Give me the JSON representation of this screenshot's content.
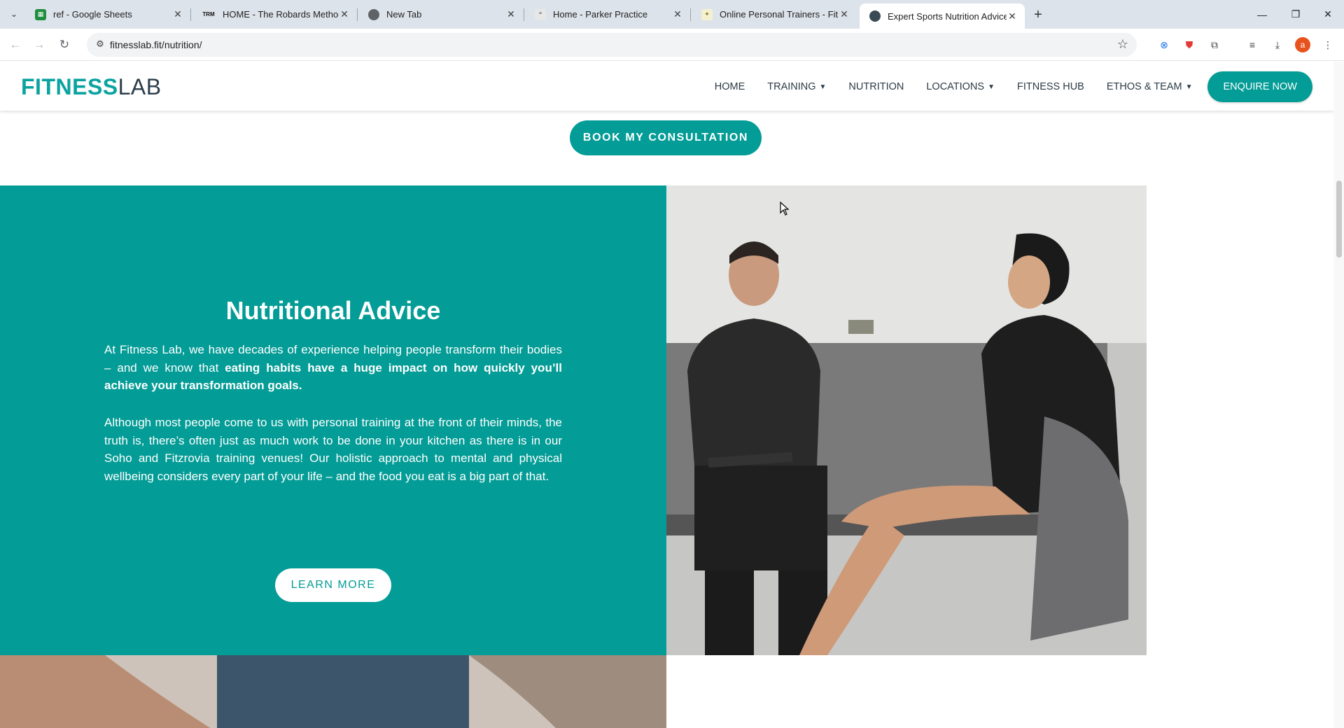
{
  "browser": {
    "tabs": [
      {
        "title": "ref - Google Sheets",
        "favicon": "sheets-icon",
        "active": false
      },
      {
        "title": "HOME - The Robards Method",
        "favicon": "trm-icon",
        "active": false
      },
      {
        "title": "New Tab",
        "favicon": "chrome-icon",
        "active": false
      },
      {
        "title": "Home - Parker Practice",
        "favicon": "pp-icon",
        "active": false
      },
      {
        "title": "Online Personal Trainers - Fitne",
        "favicon": "fitness-icon",
        "active": false
      },
      {
        "title": "Expert Sports Nutrition Advice",
        "favicon": "fitnesslab-icon",
        "active": true
      }
    ],
    "trm_favicon_text": "TRM",
    "url": "fitnesslab.fit/nutrition/",
    "profile_initial": "a"
  },
  "site": {
    "logo_bold": "FITNESS",
    "logo_light": "LAB",
    "nav": [
      {
        "label": "HOME",
        "dropdown": false
      },
      {
        "label": "TRAINING",
        "dropdown": true
      },
      {
        "label": "NUTRITION",
        "dropdown": false
      },
      {
        "label": "LOCATIONS",
        "dropdown": true
      },
      {
        "label": "FITNESS HUB",
        "dropdown": false
      },
      {
        "label": "ETHOS & TEAM",
        "dropdown": true
      }
    ],
    "enquire_label": "ENQUIRE NOW",
    "book_label": "BOOK MY CONSULTATION"
  },
  "section": {
    "heading": "Nutritional Advice",
    "p1_plain": "At Fitness Lab, we have decades of experience helping people transform their bodies – and we know that ",
    "p1_bold": "eating habits have a huge impact on how quickly you’ll achieve your transformation goals.",
    "p2": "Although most people come to us with personal training at the front of their minds, the truth is, there’s often just as much work to be done in your kitchen as there is in our Soho and Fitzrovia training venues! Our holistic approach to mental and physical wellbeing considers every part of your life – and the food you eat is a big part of that.",
    "learn_more": "LEARN MORE"
  },
  "colors": {
    "brand_teal": "#039c96",
    "logo_teal": "#0ba3a0",
    "logo_dark": "#2c3e4a"
  }
}
